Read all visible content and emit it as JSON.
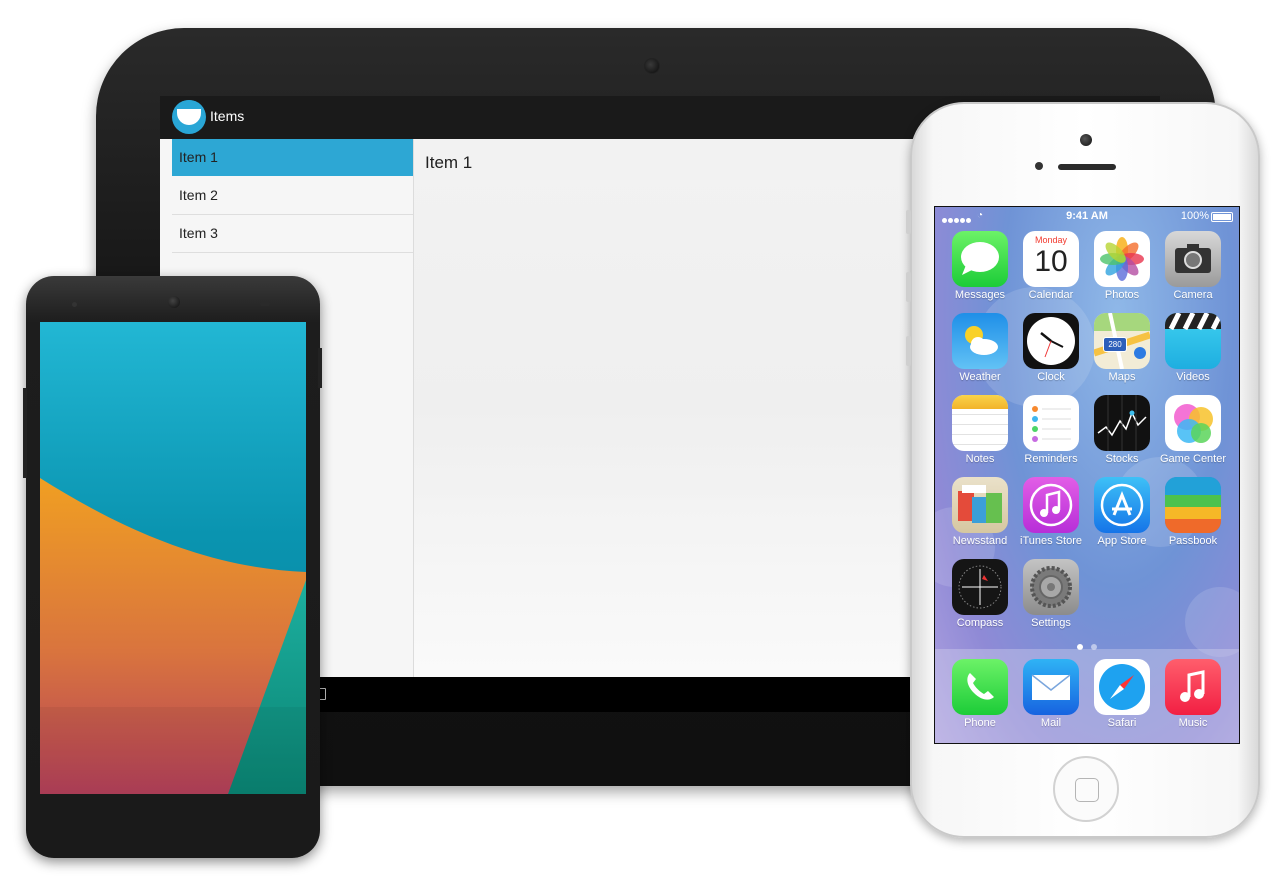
{
  "tablet": {
    "app_title": "Items",
    "list_items": [
      "Item 1",
      "Item 2",
      "Item 3"
    ],
    "selected_index": 0,
    "detail_title": "Item 1",
    "accent": "#2da7d4"
  },
  "iphone": {
    "status": {
      "time": "9:41 AM",
      "battery": "100%"
    },
    "calendar": {
      "weekday": "Monday",
      "day": "10"
    },
    "maps_shield": "280",
    "apps": [
      {
        "label": "Messages",
        "icon": "messages-icon"
      },
      {
        "label": "Calendar",
        "icon": "calendar-icon"
      },
      {
        "label": "Photos",
        "icon": "photos-icon"
      },
      {
        "label": "Camera",
        "icon": "camera-icon"
      },
      {
        "label": "Weather",
        "icon": "weather-icon"
      },
      {
        "label": "Clock",
        "icon": "clock-icon"
      },
      {
        "label": "Maps",
        "icon": "maps-icon"
      },
      {
        "label": "Videos",
        "icon": "videos-icon"
      },
      {
        "label": "Notes",
        "icon": "notes-icon"
      },
      {
        "label": "Reminders",
        "icon": "reminders-icon"
      },
      {
        "label": "Stocks",
        "icon": "stocks-icon"
      },
      {
        "label": "Game Center",
        "icon": "game-center-icon"
      },
      {
        "label": "Newsstand",
        "icon": "newsstand-icon"
      },
      {
        "label": "iTunes Store",
        "icon": "itunes-store-icon"
      },
      {
        "label": "App Store",
        "icon": "app-store-icon"
      },
      {
        "label": "Passbook",
        "icon": "passbook-icon"
      },
      {
        "label": "Compass",
        "icon": "compass-icon"
      },
      {
        "label": "Settings",
        "icon": "settings-icon"
      }
    ],
    "dock": [
      {
        "label": "Phone",
        "icon": "phone-icon"
      },
      {
        "label": "Mail",
        "icon": "mail-icon"
      },
      {
        "label": "Safari",
        "icon": "safari-icon"
      },
      {
        "label": "Music",
        "icon": "music-icon"
      }
    ],
    "page_count": 2,
    "current_page": 0
  }
}
